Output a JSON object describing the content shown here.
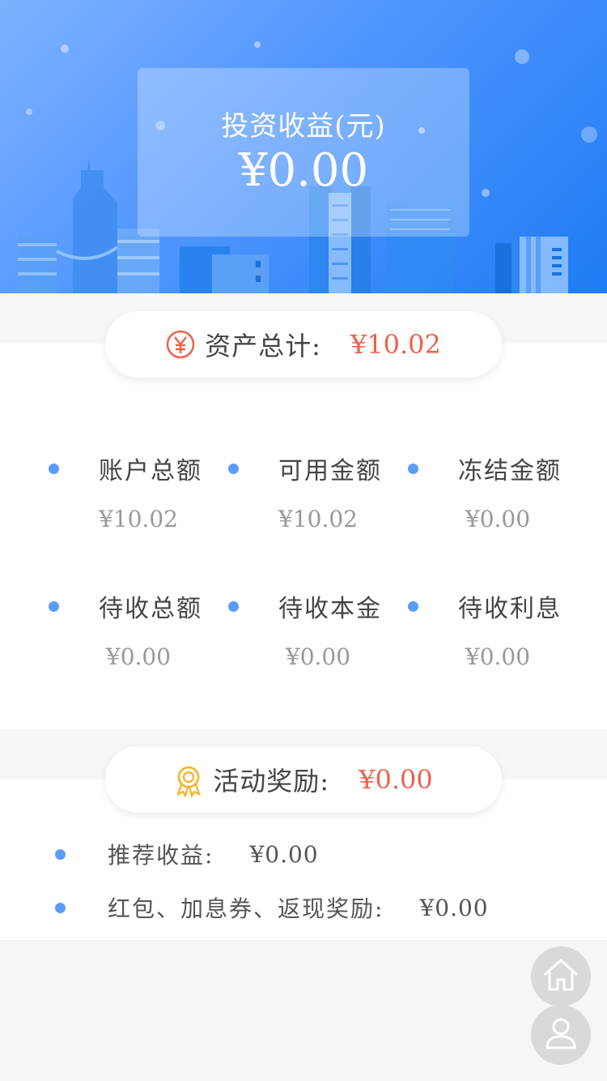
{
  "hero": {
    "label": "投资收益(元)",
    "amount": "¥0.00"
  },
  "assets": {
    "title": "资产总计:",
    "total": "¥10.02",
    "items": [
      {
        "label": "账户总额",
        "value": "¥10.02"
      },
      {
        "label": "可用金额",
        "value": "¥10.02"
      },
      {
        "label": "冻结金额",
        "value": "¥0.00"
      },
      {
        "label": "待收总额",
        "value": "¥0.00"
      },
      {
        "label": "待收本金",
        "value": "¥0.00"
      },
      {
        "label": "待收利息",
        "value": "¥0.00"
      }
    ]
  },
  "rewards": {
    "title": "活动奖励:",
    "total": "¥0.00",
    "items": [
      {
        "label": "推荐收益:",
        "value": "¥0.00"
      },
      {
        "label": "红包、加息券、返现奖励:",
        "value": "¥0.00"
      }
    ]
  },
  "float_buttons": [
    {
      "icon": "home-icon"
    },
    {
      "icon": "user-icon"
    }
  ],
  "colors": {
    "accent_red": "#f0614d",
    "dot_blue": "#5a9cf8",
    "gold": "#f5b324"
  }
}
